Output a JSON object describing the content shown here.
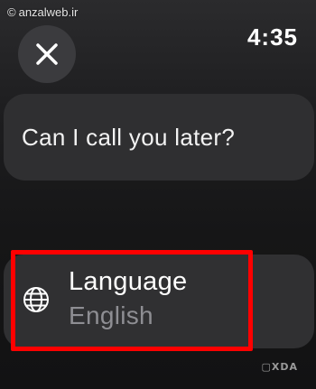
{
  "watermark": {
    "text": "anzalweb.ir",
    "at_symbol": "©"
  },
  "status": {
    "time": "4:35"
  },
  "close": {
    "icon": "close-icon"
  },
  "reply": {
    "text": "Can I call you later?"
  },
  "language": {
    "icon": "globe-icon",
    "label": "Language",
    "value": "English"
  },
  "branding": {
    "logo_text": "XDA"
  },
  "colors": {
    "highlight": "#ff0000",
    "card": "#2f2f31",
    "secondary_text": "#8e8e93"
  }
}
